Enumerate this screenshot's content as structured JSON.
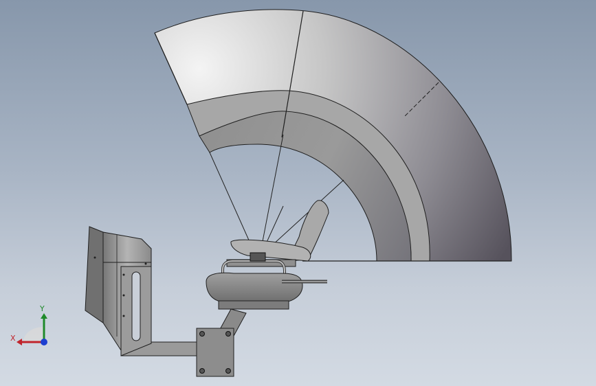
{
  "viewport": {
    "background_top": "#8797ab",
    "background_bottom": "#d3dae3"
  },
  "model": {
    "shade_colors": {
      "dome_light": "#f2f2f2",
      "dome_mid": "#b3b3b3",
      "dome_dark": "#6d6a76",
      "metal": "#8c8c8c",
      "edge": "#1e1e1e"
    }
  },
  "triad": {
    "x_label": "X",
    "y_label": "Y",
    "x_color": "#c0232b",
    "y_color": "#1f8a2a",
    "z_color": "#1d3fd0"
  }
}
